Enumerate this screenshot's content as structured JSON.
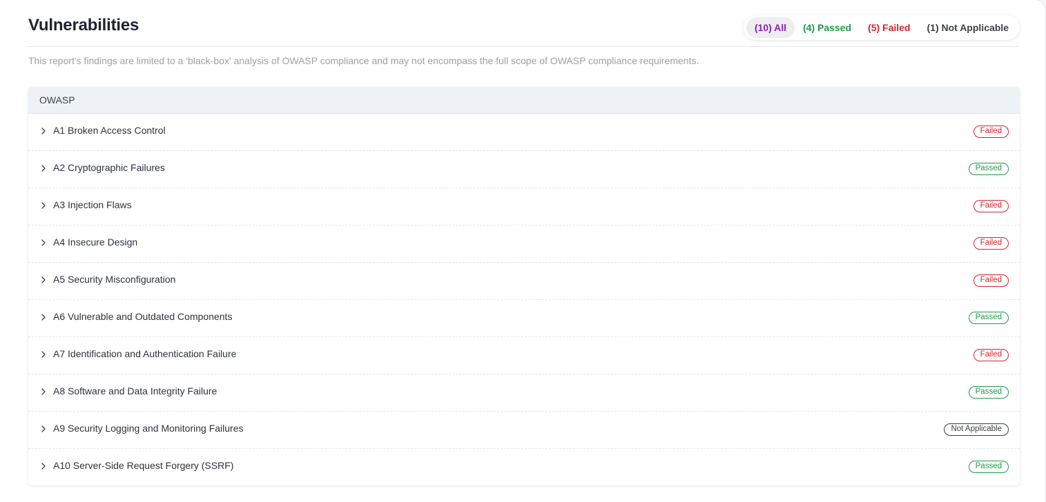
{
  "page": {
    "title": "Vulnerabilities",
    "disclaimer": "This report's findings are limited to a 'black-box' analysis of OWASP compliance and may not encompass the full scope of OWASP compliance requirements."
  },
  "filters": [
    {
      "label": "(10) All",
      "color": "#8e1fb0",
      "active": true
    },
    {
      "label": "(4) Passed",
      "color": "#1e9a48",
      "active": false
    },
    {
      "label": "(5) Failed",
      "color": "#d1242f",
      "active": false
    },
    {
      "label": "(1) Not Applicable",
      "color": "#3b3f4a",
      "active": false
    }
  ],
  "table": {
    "header": "OWASP",
    "rows": [
      {
        "label": "A1 Broken Access Control",
        "status": "Failed"
      },
      {
        "label": "A2 Cryptographic Failures",
        "status": "Passed"
      },
      {
        "label": "A3 Injection Flaws",
        "status": "Failed"
      },
      {
        "label": "A4 Insecure Design",
        "status": "Failed"
      },
      {
        "label": "A5 Security Misconfiguration",
        "status": "Failed"
      },
      {
        "label": "A6 Vulnerable and Outdated Components",
        "status": "Passed"
      },
      {
        "label": "A7 Identification and Authentication Failure",
        "status": "Failed"
      },
      {
        "label": "A8 Software and Data Integrity Failure",
        "status": "Passed"
      },
      {
        "label": "A9 Security Logging and Monitoring Failures",
        "status": "Not Applicable"
      },
      {
        "label": "A10 Server-Side Request Forgery (SSRF)",
        "status": "Passed"
      }
    ]
  },
  "status_colors": {
    "Failed": "#d1242f",
    "Passed": "#1e9a48",
    "Not Applicable": "#3b3f4a"
  },
  "icons": {
    "row_toggle": "chevron-right-icon"
  }
}
